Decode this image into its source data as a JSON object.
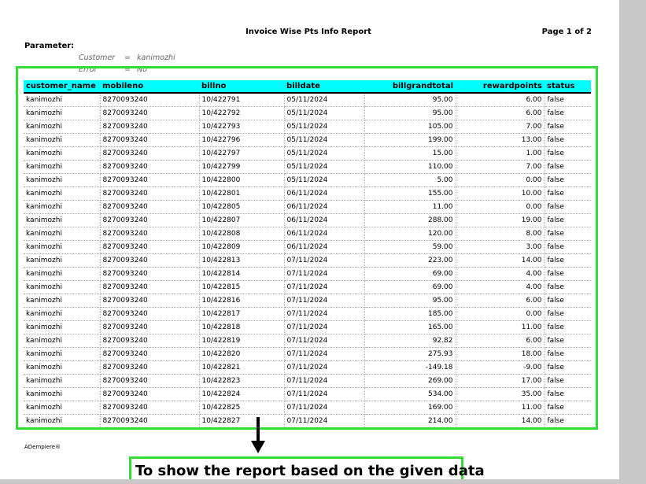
{
  "report": {
    "title": "Invoice Wise Pts Info Report",
    "page_label": "Page 1 of 2",
    "parameter_label": "Parameter:",
    "parameters": [
      {
        "name": "Customer",
        "op": "=",
        "value": "kanimozhi"
      },
      {
        "name": "Error",
        "op": "=",
        "value": "No"
      }
    ],
    "columns": [
      "customer_name",
      "mobileno",
      "billno",
      "billdate",
      "billgrandtotal",
      "rewardpoints",
      "status"
    ],
    "rows": [
      [
        "kanimozhi",
        "8270093240",
        "10/422791",
        "05/11/2024",
        "95.00",
        "6.00",
        "false"
      ],
      [
        "kanimozhi",
        "8270093240",
        "10/422792",
        "05/11/2024",
        "95.00",
        "6.00",
        "false"
      ],
      [
        "kanimozhi",
        "8270093240",
        "10/422793",
        "05/11/2024",
        "105.00",
        "7.00",
        "false"
      ],
      [
        "kanimozhi",
        "8270093240",
        "10/422796",
        "05/11/2024",
        "199.00",
        "13.00",
        "false"
      ],
      [
        "kanimozhi",
        "8270093240",
        "10/422797",
        "05/11/2024",
        "15.00",
        "1.00",
        "false"
      ],
      [
        "kanimozhi",
        "8270093240",
        "10/422799",
        "05/11/2024",
        "110.00",
        "7.00",
        "false"
      ],
      [
        "kanimozhi",
        "8270093240",
        "10/422800",
        "05/11/2024",
        "5.00",
        "0.00",
        "false"
      ],
      [
        "kanimozhi",
        "8270093240",
        "10/422801",
        "06/11/2024",
        "155.00",
        "10.00",
        "false"
      ],
      [
        "kanimozhi",
        "8270093240",
        "10/422805",
        "06/11/2024",
        "11.00",
        "0.00",
        "false"
      ],
      [
        "kanimozhi",
        "8270093240",
        "10/422807",
        "06/11/2024",
        "288.00",
        "19.00",
        "false"
      ],
      [
        "kanimozhi",
        "8270093240",
        "10/422808",
        "06/11/2024",
        "120.00",
        "8.00",
        "false"
      ],
      [
        "kanimozhi",
        "8270093240",
        "10/422809",
        "06/11/2024",
        "59.00",
        "3.00",
        "false"
      ],
      [
        "kanimozhi",
        "8270093240",
        "10/422813",
        "07/11/2024",
        "223.00",
        "14.00",
        "false"
      ],
      [
        "kanimozhi",
        "8270093240",
        "10/422814",
        "07/11/2024",
        "69.00",
        "4.00",
        "false"
      ],
      [
        "kanimozhi",
        "8270093240",
        "10/422815",
        "07/11/2024",
        "69.00",
        "4.00",
        "false"
      ],
      [
        "kanimozhi",
        "8270093240",
        "10/422816",
        "07/11/2024",
        "95.00",
        "6.00",
        "false"
      ],
      [
        "kanimozhi",
        "8270093240",
        "10/422817",
        "07/11/2024",
        "185.00",
        "0.00",
        "false"
      ],
      [
        "kanimozhi",
        "8270093240",
        "10/422818",
        "07/11/2024",
        "165.00",
        "11.00",
        "false"
      ],
      [
        "kanimozhi",
        "8270093240",
        "10/422819",
        "07/11/2024",
        "92.82",
        "6.00",
        "false"
      ],
      [
        "kanimozhi",
        "8270093240",
        "10/422820",
        "07/11/2024",
        "275.93",
        "18.00",
        "false"
      ],
      [
        "kanimozhi",
        "8270093240",
        "10/422821",
        "07/11/2024",
        "-149.18",
        "-9.00",
        "false"
      ],
      [
        "kanimozhi",
        "8270093240",
        "10/422823",
        "07/11/2024",
        "269.00",
        "17.00",
        "false"
      ],
      [
        "kanimozhi",
        "8270093240",
        "10/422824",
        "07/11/2024",
        "534.00",
        "35.00",
        "false"
      ],
      [
        "kanimozhi",
        "8270093240",
        "10/422825",
        "07/11/2024",
        "169.00",
        "11.00",
        "false"
      ],
      [
        "kanimozhi",
        "8270093240",
        "10/422827",
        "07/11/2024",
        "214.00",
        "14.00",
        "false"
      ]
    ],
    "footer_brand": "ADempiere®"
  },
  "annotation": {
    "caption": "To show the report based on the given data",
    "highlight_color": "#33dd33",
    "header_color": "#00ffff"
  }
}
